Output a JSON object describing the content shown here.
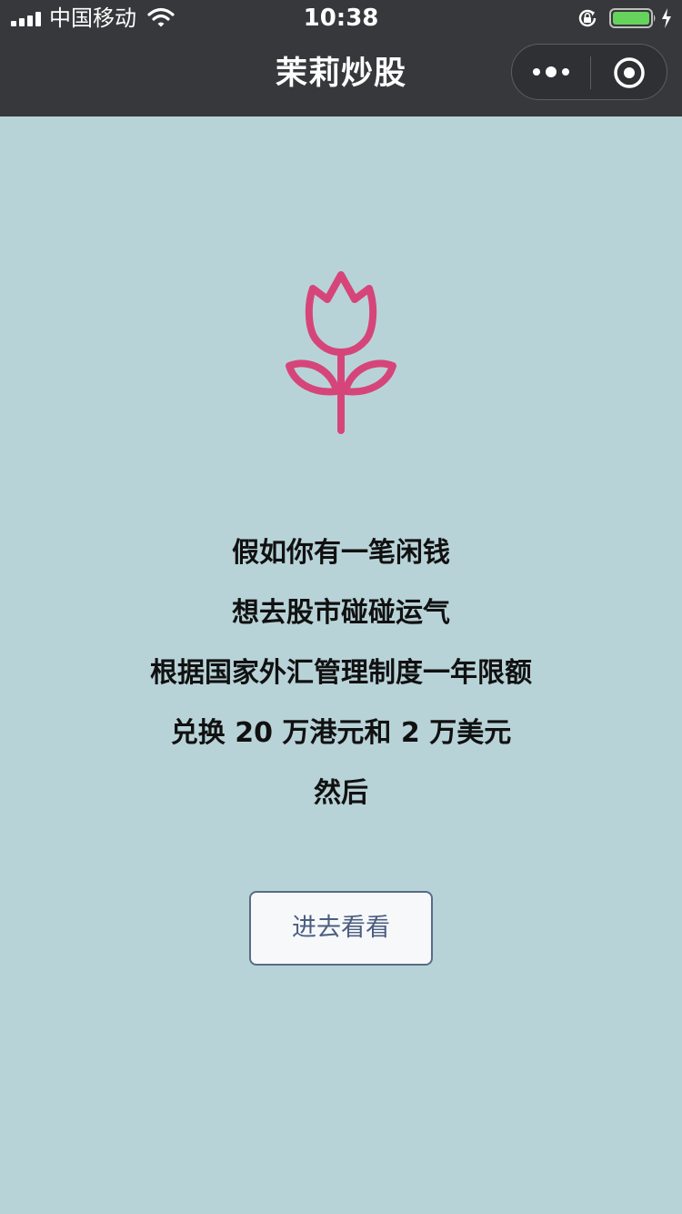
{
  "status_bar": {
    "carrier": "中国移动",
    "time": "10:38",
    "battery_level": 1.0,
    "icons": [
      "signal-icon",
      "wifi-icon",
      "rotation-lock-icon",
      "battery-icon",
      "charging-icon"
    ]
  },
  "nav": {
    "title": "茉莉炒股",
    "icons": [
      "more-icon",
      "close-icon"
    ]
  },
  "content": {
    "icon": "tulip-icon",
    "accent_color": "#d6457a",
    "lines": [
      "假如你有一笔闲钱",
      "想去股市碰碰运气",
      "根据国家外汇管理制度一年限额",
      "兑换 20 万港元和 2 万美元",
      "然后"
    ],
    "button_label": "进去看看"
  },
  "colors": {
    "background": "#b8d3d8",
    "header": "#37383b",
    "button_border": "#596b86",
    "button_text": "#4b5e80"
  }
}
